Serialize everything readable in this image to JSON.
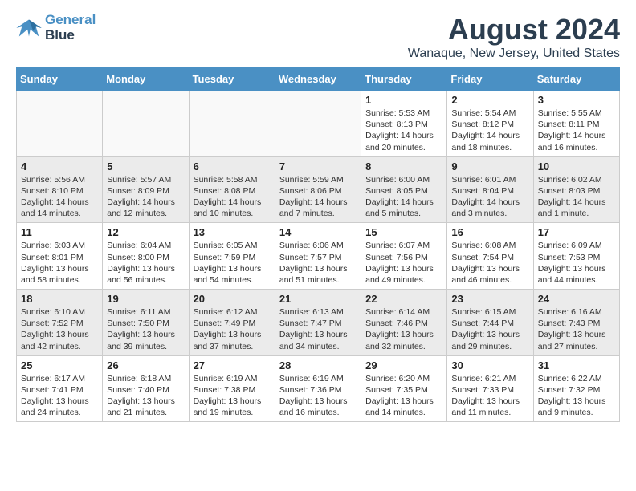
{
  "header": {
    "logo_line1": "General",
    "logo_line2": "Blue",
    "month_title": "August 2024",
    "location": "Wanaque, New Jersey, United States"
  },
  "weekdays": [
    "Sunday",
    "Monday",
    "Tuesday",
    "Wednesday",
    "Thursday",
    "Friday",
    "Saturday"
  ],
  "rows": [
    [
      {
        "day": "",
        "info": ""
      },
      {
        "day": "",
        "info": ""
      },
      {
        "day": "",
        "info": ""
      },
      {
        "day": "",
        "info": ""
      },
      {
        "day": "1",
        "info": "Sunrise: 5:53 AM\nSunset: 8:13 PM\nDaylight: 14 hours\nand 20 minutes."
      },
      {
        "day": "2",
        "info": "Sunrise: 5:54 AM\nSunset: 8:12 PM\nDaylight: 14 hours\nand 18 minutes."
      },
      {
        "day": "3",
        "info": "Sunrise: 5:55 AM\nSunset: 8:11 PM\nDaylight: 14 hours\nand 16 minutes."
      }
    ],
    [
      {
        "day": "4",
        "info": "Sunrise: 5:56 AM\nSunset: 8:10 PM\nDaylight: 14 hours\nand 14 minutes."
      },
      {
        "day": "5",
        "info": "Sunrise: 5:57 AM\nSunset: 8:09 PM\nDaylight: 14 hours\nand 12 minutes."
      },
      {
        "day": "6",
        "info": "Sunrise: 5:58 AM\nSunset: 8:08 PM\nDaylight: 14 hours\nand 10 minutes."
      },
      {
        "day": "7",
        "info": "Sunrise: 5:59 AM\nSunset: 8:06 PM\nDaylight: 14 hours\nand 7 minutes."
      },
      {
        "day": "8",
        "info": "Sunrise: 6:00 AM\nSunset: 8:05 PM\nDaylight: 14 hours\nand 5 minutes."
      },
      {
        "day": "9",
        "info": "Sunrise: 6:01 AM\nSunset: 8:04 PM\nDaylight: 14 hours\nand 3 minutes."
      },
      {
        "day": "10",
        "info": "Sunrise: 6:02 AM\nSunset: 8:03 PM\nDaylight: 14 hours\nand 1 minute."
      }
    ],
    [
      {
        "day": "11",
        "info": "Sunrise: 6:03 AM\nSunset: 8:01 PM\nDaylight: 13 hours\nand 58 minutes."
      },
      {
        "day": "12",
        "info": "Sunrise: 6:04 AM\nSunset: 8:00 PM\nDaylight: 13 hours\nand 56 minutes."
      },
      {
        "day": "13",
        "info": "Sunrise: 6:05 AM\nSunset: 7:59 PM\nDaylight: 13 hours\nand 54 minutes."
      },
      {
        "day": "14",
        "info": "Sunrise: 6:06 AM\nSunset: 7:57 PM\nDaylight: 13 hours\nand 51 minutes."
      },
      {
        "day": "15",
        "info": "Sunrise: 6:07 AM\nSunset: 7:56 PM\nDaylight: 13 hours\nand 49 minutes."
      },
      {
        "day": "16",
        "info": "Sunrise: 6:08 AM\nSunset: 7:54 PM\nDaylight: 13 hours\nand 46 minutes."
      },
      {
        "day": "17",
        "info": "Sunrise: 6:09 AM\nSunset: 7:53 PM\nDaylight: 13 hours\nand 44 minutes."
      }
    ],
    [
      {
        "day": "18",
        "info": "Sunrise: 6:10 AM\nSunset: 7:52 PM\nDaylight: 13 hours\nand 42 minutes."
      },
      {
        "day": "19",
        "info": "Sunrise: 6:11 AM\nSunset: 7:50 PM\nDaylight: 13 hours\nand 39 minutes."
      },
      {
        "day": "20",
        "info": "Sunrise: 6:12 AM\nSunset: 7:49 PM\nDaylight: 13 hours\nand 37 minutes."
      },
      {
        "day": "21",
        "info": "Sunrise: 6:13 AM\nSunset: 7:47 PM\nDaylight: 13 hours\nand 34 minutes."
      },
      {
        "day": "22",
        "info": "Sunrise: 6:14 AM\nSunset: 7:46 PM\nDaylight: 13 hours\nand 32 minutes."
      },
      {
        "day": "23",
        "info": "Sunrise: 6:15 AM\nSunset: 7:44 PM\nDaylight: 13 hours\nand 29 minutes."
      },
      {
        "day": "24",
        "info": "Sunrise: 6:16 AM\nSunset: 7:43 PM\nDaylight: 13 hours\nand 27 minutes."
      }
    ],
    [
      {
        "day": "25",
        "info": "Sunrise: 6:17 AM\nSunset: 7:41 PM\nDaylight: 13 hours\nand 24 minutes."
      },
      {
        "day": "26",
        "info": "Sunrise: 6:18 AM\nSunset: 7:40 PM\nDaylight: 13 hours\nand 21 minutes."
      },
      {
        "day": "27",
        "info": "Sunrise: 6:19 AM\nSunset: 7:38 PM\nDaylight: 13 hours\nand 19 minutes."
      },
      {
        "day": "28",
        "info": "Sunrise: 6:19 AM\nSunset: 7:36 PM\nDaylight: 13 hours\nand 16 minutes."
      },
      {
        "day": "29",
        "info": "Sunrise: 6:20 AM\nSunset: 7:35 PM\nDaylight: 13 hours\nand 14 minutes."
      },
      {
        "day": "30",
        "info": "Sunrise: 6:21 AM\nSunset: 7:33 PM\nDaylight: 13 hours\nand 11 minutes."
      },
      {
        "day": "31",
        "info": "Sunrise: 6:22 AM\nSunset: 7:32 PM\nDaylight: 13 hours\nand 9 minutes."
      }
    ]
  ]
}
